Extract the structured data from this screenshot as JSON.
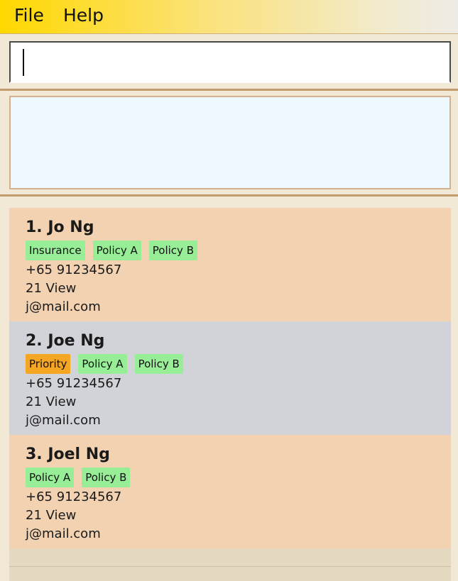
{
  "menu": {
    "file_label": "File",
    "help_label": "Help"
  },
  "command": {
    "value": ""
  },
  "result": {
    "text": ""
  },
  "persons": [
    {
      "index_name": "1. Jo Ng",
      "tags": [
        {
          "label": "Insurance",
          "type": "normal"
        },
        {
          "label": "Policy A",
          "type": "normal"
        },
        {
          "label": "Policy B",
          "type": "normal"
        }
      ],
      "phone": "+65 91234567",
      "address": "21 View",
      "email": "j@mail.com"
    },
    {
      "index_name": "2. Joe Ng",
      "tags": [
        {
          "label": "Priority",
          "type": "priority"
        },
        {
          "label": "Policy A",
          "type": "normal"
        },
        {
          "label": "Policy B",
          "type": "normal"
        }
      ],
      "phone": "+65 91234567",
      "address": "21 View",
      "email": "j@mail.com"
    },
    {
      "index_name": "3. Joel Ng",
      "tags": [
        {
          "label": "Policy A",
          "type": "normal"
        },
        {
          "label": "Policy B",
          "type": "normal"
        }
      ],
      "phone": "+65 91234567",
      "address": "21 View",
      "email": "j@mail.com"
    }
  ],
  "colors": {
    "card_odd": "#f2d2b1",
    "card_even": "#d2d3d8",
    "tag_normal": "#97ee97",
    "tag_priority": "#f5a623",
    "result_background": "#eef9ff"
  }
}
